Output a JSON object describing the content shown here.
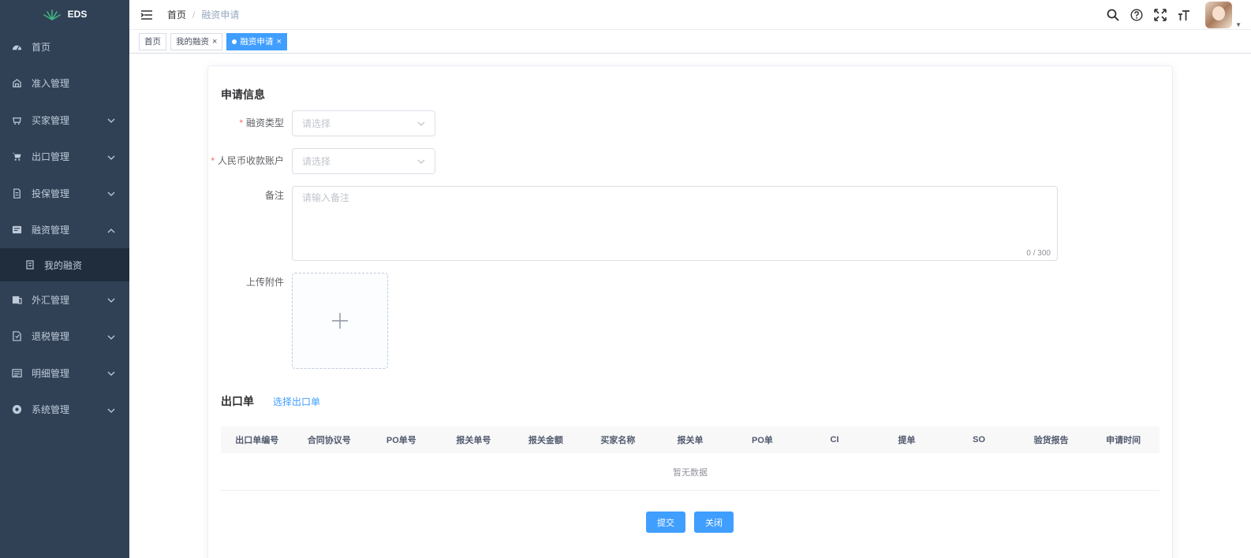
{
  "app": {
    "logo_text": "EDS"
  },
  "sidebar": {
    "items": [
      {
        "label": "首页",
        "icon": "dashboard-icon",
        "has_arrow": false
      },
      {
        "label": "准入管理",
        "icon": "admission-icon",
        "has_arrow": false
      },
      {
        "label": "买家管理",
        "icon": "buyer-icon",
        "has_arrow": true,
        "arrow": "down"
      },
      {
        "label": "出口管理",
        "icon": "cart-icon",
        "has_arrow": true,
        "arrow": "down"
      },
      {
        "label": "投保管理",
        "icon": "insurance-icon",
        "has_arrow": true,
        "arrow": "down"
      },
      {
        "label": "融资管理",
        "icon": "finance-icon",
        "has_arrow": true,
        "arrow": "up"
      },
      {
        "label": "外汇管理",
        "icon": "forex-icon",
        "has_arrow": true,
        "arrow": "down"
      },
      {
        "label": "退税管理",
        "icon": "tax-refund-icon",
        "has_arrow": true,
        "arrow": "down"
      },
      {
        "label": "明细管理",
        "icon": "detail-icon",
        "has_arrow": true,
        "arrow": "down"
      },
      {
        "label": "系统管理",
        "icon": "system-icon",
        "has_arrow": true,
        "arrow": "down"
      }
    ],
    "subitem": {
      "label": "我的融资",
      "icon": "document-icon"
    }
  },
  "navbar": {
    "breadcrumb_home": "首页",
    "breadcrumb_sep": "/",
    "breadcrumb_current": "融资申请",
    "icons": [
      "search-icon",
      "help-icon",
      "fullscreen-icon",
      "font-size-icon"
    ]
  },
  "tags": {
    "items": [
      {
        "label": "首页",
        "closable": false,
        "active": false
      },
      {
        "label": "我的融资",
        "closable": true,
        "active": false
      },
      {
        "label": "融资申请",
        "closable": true,
        "active": true
      }
    ],
    "close_symbol": "×"
  },
  "form": {
    "section_title": "申请信息",
    "required_mark": "*",
    "finance_type": {
      "label": "融资类型",
      "placeholder": "请选择"
    },
    "rmb_account": {
      "label": "人民币收款账户",
      "placeholder": "请选择"
    },
    "remark": {
      "label": "备注",
      "placeholder": "请输入备注",
      "count": "0 / 300"
    },
    "attachment": {
      "label": "上传附件"
    }
  },
  "export": {
    "title": "出口单",
    "select_link": "选择出口单",
    "columns": [
      "出口单编号",
      "合同协议号",
      "PO单号",
      "报关单号",
      "报关金额",
      "买家名称",
      "报关单",
      "PO单",
      "CI",
      "提单",
      "SO",
      "验货报告",
      "申请时间"
    ],
    "empty_text": "暂无数据"
  },
  "actions": {
    "submit": "提交",
    "close": "关闭"
  },
  "colors": {
    "sidebar_bg": "#304156",
    "primary": "#409eff",
    "required": "#f56c6c"
  }
}
